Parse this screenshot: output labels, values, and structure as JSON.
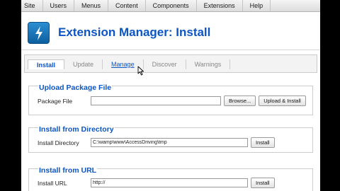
{
  "menubar": {
    "items": [
      "Site",
      "Users",
      "Menus",
      "Content",
      "Components",
      "Extensions",
      "Help"
    ]
  },
  "header": {
    "title": "Extension Manager: Install",
    "icon": "extension-manager-icon"
  },
  "tabs": [
    {
      "label": "Install",
      "state": "active"
    },
    {
      "label": "Update",
      "state": "normal"
    },
    {
      "label": "Manage",
      "state": "hover"
    },
    {
      "label": "Discover",
      "state": "normal"
    },
    {
      "label": "Warnings",
      "state": "normal"
    }
  ],
  "upload_package": {
    "legend": "Upload Package File",
    "label": "Package File",
    "value": "",
    "browse_label": "Browse...",
    "submit_label": "Upload & Install"
  },
  "install_directory": {
    "legend": "Install from Directory",
    "label": "Install Directory",
    "value": "C:\\wamp\\www\\AccessDriving\\tmp",
    "submit_label": "Install"
  },
  "install_url": {
    "legend": "Install from URL",
    "label": "Install URL",
    "value": "http://",
    "submit_label": "Install"
  },
  "colors": {
    "accent": "#0b55c4",
    "icon_blue": "#1a7cc4"
  }
}
